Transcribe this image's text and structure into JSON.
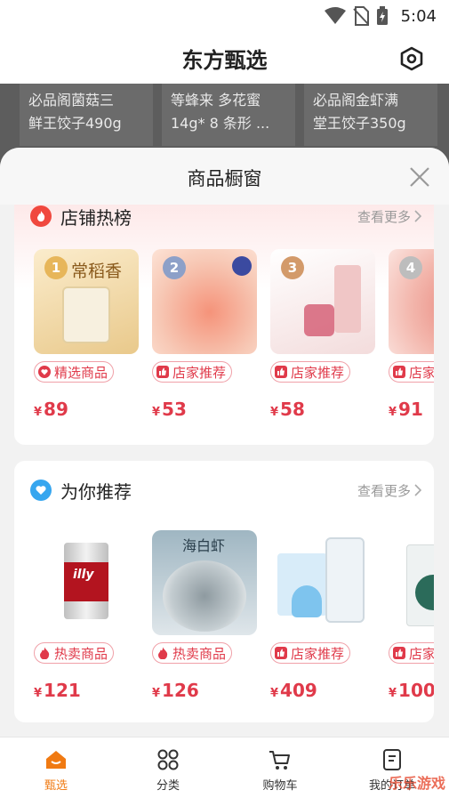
{
  "status": {
    "time": "5:04",
    "icons": [
      "wifi-icon",
      "no-sim-icon",
      "battery-charging-icon"
    ]
  },
  "header": {
    "title": "东方甄选",
    "settings_icon": "hexagon-settings-icon"
  },
  "background_products": [
    {
      "line1": "必品阁菌菇三",
      "line2": "鲜王饺子490g"
    },
    {
      "line1": "等蜂来 多花蜜",
      "line2": "14g* 8 条形 ..."
    },
    {
      "line1": "必品阁金虾满",
      "line2": "堂王饺子350g"
    }
  ],
  "sheet": {
    "title": "商品橱窗",
    "close_icon": "close-icon"
  },
  "hot_section": {
    "title": "店铺热榜",
    "more": "查看更多",
    "icon": "fire-icon",
    "items": [
      {
        "rank": "1",
        "tag": "精选商品",
        "tag_icon": "heart-icon",
        "currency": "¥",
        "price": "89",
        "thumb_text": "常稻香",
        "thumb_color": "#f6dca6"
      },
      {
        "rank": "2",
        "tag": "店家推荐",
        "tag_icon": "thumbs-up-icon",
        "currency": "¥",
        "price": "53",
        "thumb_color": "#f3a58a"
      },
      {
        "rank": "3",
        "tag": "店家推荐",
        "tag_icon": "thumbs-up-icon",
        "currency": "¥",
        "price": "58",
        "thumb_color": "#f6dede"
      },
      {
        "rank": "4",
        "tag": "店家推荐",
        "tag_icon": "thumbs-up-icon",
        "currency": "¥",
        "price": "91",
        "thumb_color": "#f4b2a6"
      }
    ]
  },
  "rec_section": {
    "title": "为你推荐",
    "more": "查看更多",
    "icon": "heart-badge-icon",
    "items": [
      {
        "tag": "热卖商品",
        "tag_icon": "fire-small-icon",
        "currency": "¥",
        "price": "121",
        "thumb_text": "illy",
        "thumb_color": "#ffffff"
      },
      {
        "tag": "热卖商品",
        "tag_icon": "fire-small-icon",
        "currency": "¥",
        "price": "126",
        "thumb_text": "海白虾",
        "thumb_color": "#c9d6dc"
      },
      {
        "tag": "店家推荐",
        "tag_icon": "thumbs-up-icon",
        "currency": "¥",
        "price": "409",
        "thumb_color": "#e7f1f9"
      },
      {
        "tag": "店家推荐",
        "tag_icon": "thumbs-up-icon",
        "currency": "¥",
        "price": "100",
        "thumb_color": "#eef2f2"
      }
    ]
  },
  "bottom_nav": [
    {
      "label": "甄选",
      "icon": "home-icon",
      "active": true
    },
    {
      "label": "分类",
      "icon": "grid-icon",
      "active": false
    },
    {
      "label": "购物车",
      "icon": "cart-icon",
      "active": false
    },
    {
      "label": "我的订单",
      "icon": "order-icon",
      "active": false
    }
  ],
  "watermark": "乐乐游戏",
  "colors": {
    "accent": "#f07a12",
    "price": "#e03a4a",
    "hot_icon": "#f0483e",
    "rec_icon": "#36a6ef"
  }
}
